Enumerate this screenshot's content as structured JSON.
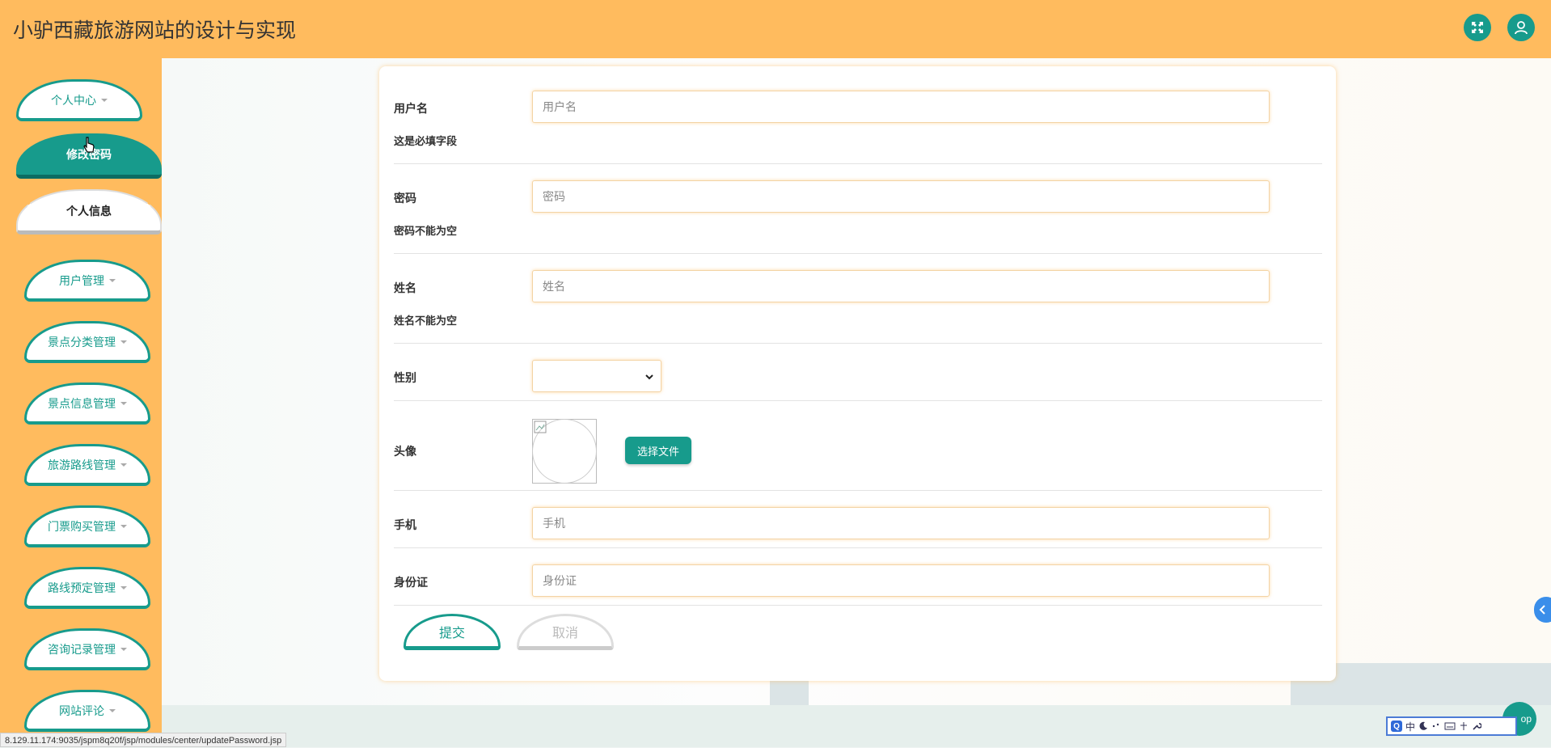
{
  "header": {
    "title": "小驴西藏旅游网站的设计与实现"
  },
  "sidebar": {
    "personal_center": "个人中心",
    "sub_change_password": "修改密码",
    "sub_personal_info": "个人信息",
    "items": [
      {
        "label": "用户管理"
      },
      {
        "label": "景点分类管理"
      },
      {
        "label": "景点信息管理"
      },
      {
        "label": "旅游路线管理"
      },
      {
        "label": "门票购买管理"
      },
      {
        "label": "路线预定管理"
      },
      {
        "label": "咨询记录管理"
      },
      {
        "label": "网站评论"
      }
    ]
  },
  "form": {
    "username": {
      "label": "用户名",
      "placeholder": "用户名",
      "hint": "这是必填字段"
    },
    "password": {
      "label": "密码",
      "placeholder": "密码",
      "hint": "密码不能为空"
    },
    "name": {
      "label": "姓名",
      "placeholder": "姓名",
      "hint": "姓名不能为空"
    },
    "gender": {
      "label": "性别"
    },
    "avatar": {
      "label": "头像",
      "button": "选择文件"
    },
    "phone": {
      "label": "手机",
      "placeholder": "手机"
    },
    "idcard": {
      "label": "身份证",
      "placeholder": "身份证"
    },
    "submit": "提交",
    "cancel": "取消"
  },
  "status_url": "8.129.11.174:9035/jspm8q20f/jsp/modules/center/updatePassword.jsp",
  "ime": {
    "q": "Q",
    "mode": "中"
  },
  "top_label": "op",
  "colors": {
    "accent": "#179b8c",
    "header": "#ffbb5e"
  }
}
